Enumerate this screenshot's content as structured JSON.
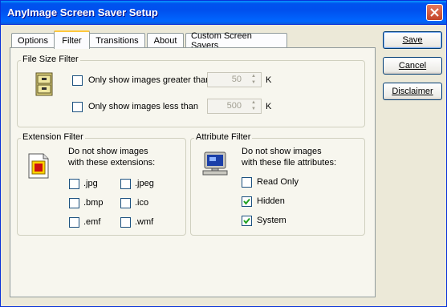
{
  "window": {
    "title": "AnyImage Screen Saver Setup"
  },
  "tabs": [
    {
      "label": "Options"
    },
    {
      "label": "Filter"
    },
    {
      "label": "Transitions"
    },
    {
      "label": "About"
    },
    {
      "label": "Custom Screen Savers"
    }
  ],
  "active_tab": "Filter",
  "file_size_filter": {
    "title": "File Size Filter",
    "greater": {
      "label": "Only show images greater than",
      "checked": false,
      "value": "50",
      "unit": "K"
    },
    "less": {
      "label": "Only show images less than",
      "checked": false,
      "value": "500",
      "unit": "K"
    }
  },
  "extension_filter": {
    "title": "Extension Filter",
    "line1": "Do not show images",
    "line2": "with these extensions:",
    "items": [
      {
        "label": ".jpg",
        "checked": false
      },
      {
        "label": ".jpeg",
        "checked": false
      },
      {
        "label": ".bmp",
        "checked": false
      },
      {
        "label": ".ico",
        "checked": false
      },
      {
        "label": ".emf",
        "checked": false
      },
      {
        "label": ".wmf",
        "checked": false
      }
    ]
  },
  "attribute_filter": {
    "title": "Attribute Filter",
    "line1": "Do not show images",
    "line2": "with these file attributes:",
    "items": [
      {
        "label": "Read Only",
        "checked": false
      },
      {
        "label": "Hidden",
        "checked": true
      },
      {
        "label": "System",
        "checked": true
      }
    ]
  },
  "buttons": {
    "save": "Save",
    "cancel": "Cancel",
    "disclaimer": "Disclaimer"
  },
  "icons": {
    "close": "close-icon",
    "file_cabinet": "file-cabinet-icon",
    "image_document": "image-document-icon",
    "computer": "computer-icon",
    "checkmark": "checkmark-icon"
  }
}
